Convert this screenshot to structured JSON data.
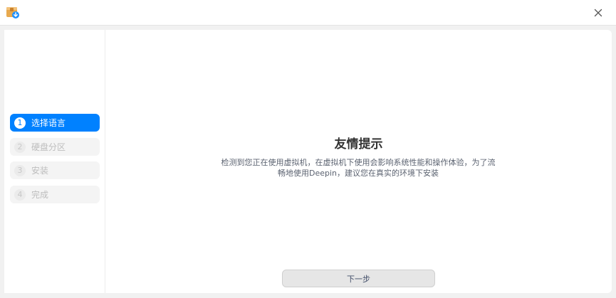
{
  "titlebar": {
    "app_icon": "installer-package-icon",
    "close_icon": "close-icon"
  },
  "sidebar": {
    "steps": [
      {
        "number": "1",
        "label": "选择语言",
        "active": true
      },
      {
        "number": "2",
        "label": "硬盘分区",
        "active": false
      },
      {
        "number": "3",
        "label": "安装",
        "active": false
      },
      {
        "number": "4",
        "label": "完成",
        "active": false
      }
    ]
  },
  "main": {
    "title": "友情提示",
    "description": "检测到您正在使用虚拟机，在虚拟机下使用会影响系统性能和操作体验，为了流畅地使用Deepin，建议您在真实的环境下安装",
    "next_button": "下一步"
  },
  "colors": {
    "accent": "#0081ff",
    "app_icon_body": "#e8a94e",
    "app_icon_badge": "#1e90ff"
  }
}
